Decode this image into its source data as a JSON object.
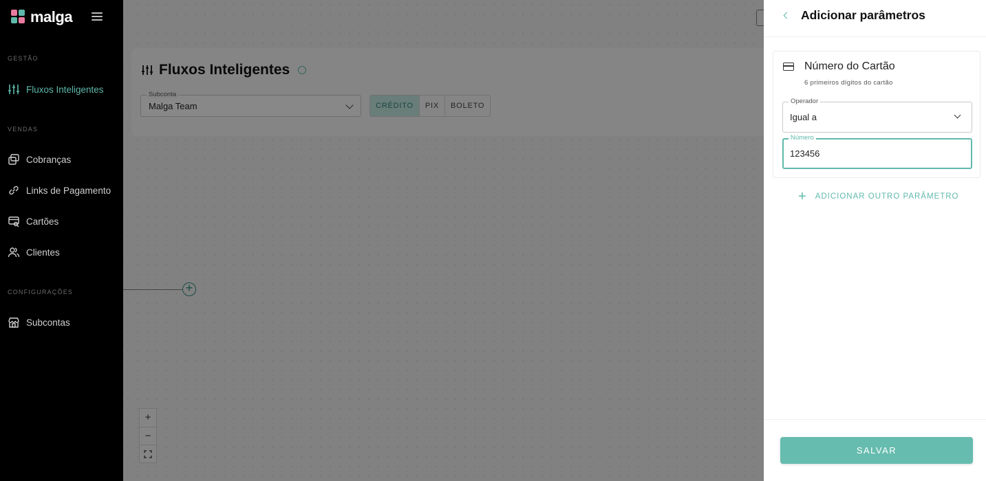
{
  "colors": {
    "accent": "#5fb9ab",
    "sidebar_bg": "#000000",
    "save_bg": "#66bcae"
  },
  "sidebar": {
    "logo": "malga",
    "sections": [
      {
        "title": "GESTÃO",
        "items": [
          {
            "label": "Fluxos Inteligentes",
            "icon": "sliders-icon",
            "active": true
          }
        ]
      },
      {
        "title": "VENDAS",
        "items": [
          {
            "label": "Cobranças",
            "icon": "charges-icon"
          },
          {
            "label": "Links de Pagamento",
            "icon": "link-icon"
          },
          {
            "label": "Cartões",
            "icon": "card-search-icon"
          },
          {
            "label": "Clientes",
            "icon": "users-icon"
          }
        ]
      },
      {
        "title": "CONFIGURAÇÕES",
        "items": [
          {
            "label": "Subcontas",
            "icon": "store-icon"
          }
        ]
      }
    ]
  },
  "main": {
    "title": "Fluxos Inteligentes",
    "subconta": {
      "label": "Subconta",
      "value": "Malga Team"
    },
    "payment_methods": [
      "CRÉDITO",
      "PIX",
      "BOLETO"
    ],
    "selected_method": "CRÉDITO",
    "zoom": {
      "in": "+",
      "out": "−"
    }
  },
  "drawer": {
    "title": "Adicionar parâmetros",
    "parameter": {
      "title": "Número do Cartão",
      "subtitle": "6 primeiros dígitos do cartão",
      "operator": {
        "label": "Operador",
        "value": "Igual a"
      },
      "number": {
        "label": "Número",
        "value": "123456"
      }
    },
    "add_param_label": "ADICIONAR OUTRO PARÂMETRO",
    "save_label": "SALVAR"
  }
}
